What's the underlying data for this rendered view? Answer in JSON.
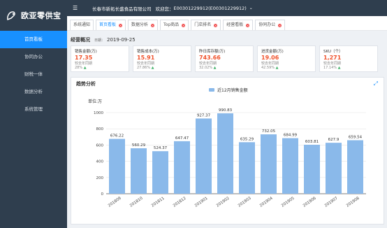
{
  "app": {
    "name": "欧亚零供宝",
    "company": "长春市新拓长盛食品有限公司",
    "welcome": "欢迎您：",
    "user": "E00301229912(E00301229912)",
    "user_menu_icon": "chevron-down-icon"
  },
  "sidebar": {
    "items": [
      {
        "label": "首页看板",
        "active": true
      },
      {
        "label": "协同办公",
        "active": false
      },
      {
        "label": "财税一体",
        "active": false
      },
      {
        "label": "数据分析",
        "active": false
      },
      {
        "label": "系统管理",
        "active": false
      }
    ]
  },
  "tabs": [
    {
      "label": "系统通知",
      "closable": false,
      "active": false
    },
    {
      "label": "首页看板",
      "closable": true,
      "active": true
    },
    {
      "label": "数据分析",
      "closable": true,
      "active": false
    },
    {
      "label": "Top商品",
      "closable": true,
      "active": false
    },
    {
      "label": "门店排名",
      "closable": true,
      "active": false
    },
    {
      "label": "经营看板",
      "closable": true,
      "active": false
    },
    {
      "label": "协同办公",
      "closable": true,
      "active": false
    }
  ],
  "overview": {
    "title": "经营概况",
    "date_label": "日期：",
    "date": "2019-09-25",
    "cards": [
      {
        "title": "销售金额(万)",
        "value": "17.35",
        "compare_label": "较去年同期",
        "rate": "28%",
        "trend": "up"
      },
      {
        "title": "销售成本(万)",
        "value": "15.91",
        "compare_label": "较去年同期",
        "rate": "27.86%",
        "trend": "up"
      },
      {
        "title": "昨日库存额(万)",
        "value": "743.66",
        "compare_label": "较去年同期",
        "rate": "32.02%",
        "trend": "up"
      },
      {
        "title": "进货金额(万)",
        "value": "19.06",
        "compare_label": "较去年同期",
        "rate": "42.59%",
        "trend": "up"
      },
      {
        "title": "SKU（个）",
        "value": "1,271",
        "compare_label": "较去年同期",
        "rate": "17.14%",
        "trend": "up"
      }
    ]
  },
  "trend": {
    "title": "趋势分析",
    "expand_icon": "expand-icon"
  },
  "colors": {
    "sidebar_bg": "#2f3e4e",
    "primary": "#1890ff",
    "bar": "#8ab9ea",
    "value_red": "#f0522c",
    "rate_green": "#45b36b"
  },
  "chart_data": {
    "type": "bar",
    "legend": "近12月销售金额",
    "unit": "单位:万",
    "categories": [
      "201809",
      "201810",
      "201811",
      "201812",
      "201901",
      "201902",
      "201903",
      "201904",
      "201905",
      "201906",
      "201907",
      "201908"
    ],
    "values": [
      676.22,
      560.29,
      524.37,
      647.47,
      927.37,
      990.83,
      635.29,
      732.05,
      684.99,
      603.81,
      627.9,
      659.54
    ],
    "ylim": [
      0,
      1000
    ],
    "yticks": [
      0,
      200,
      400,
      600,
      800,
      1000
    ]
  }
}
